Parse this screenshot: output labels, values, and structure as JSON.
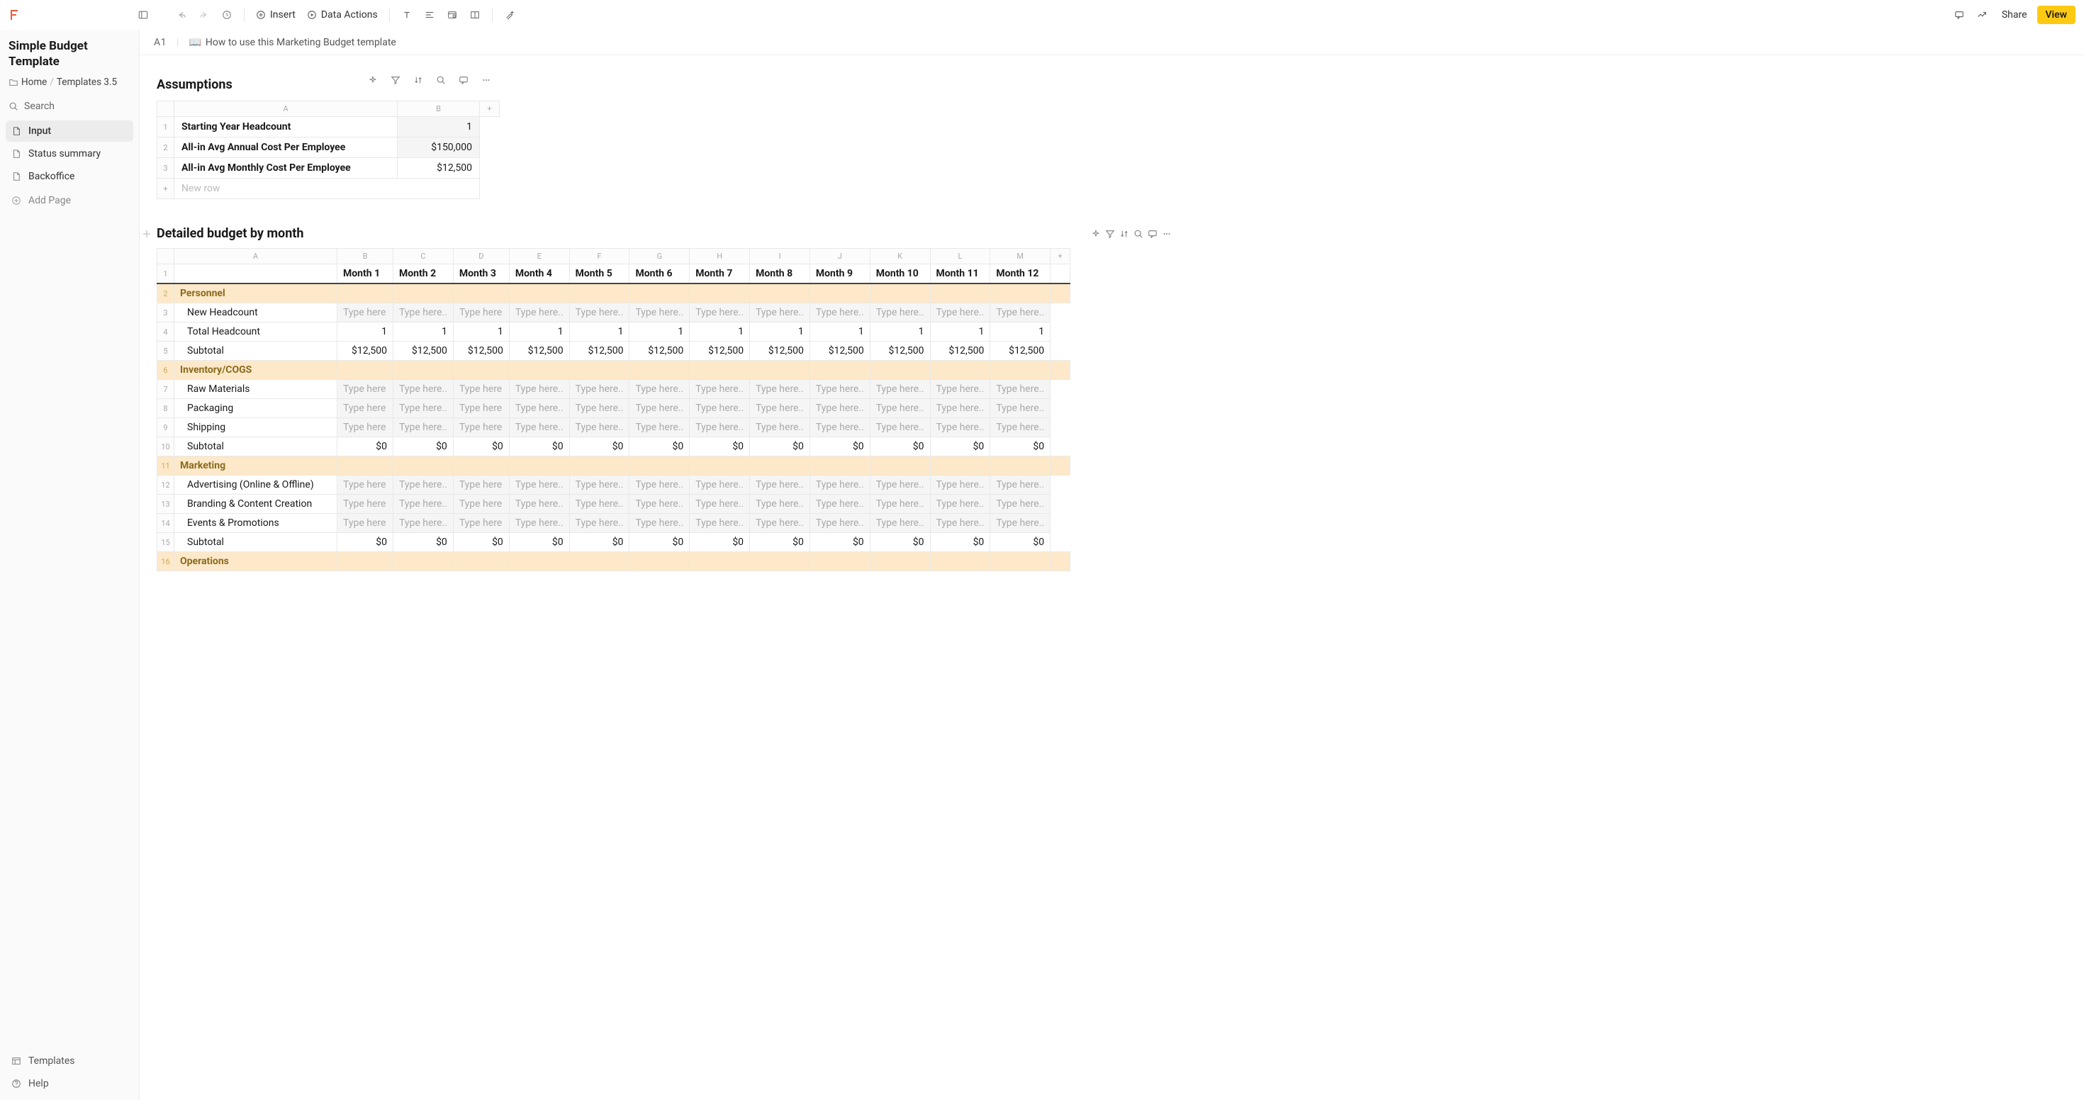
{
  "toolbar": {
    "insert_label": "Insert",
    "data_actions_label": "Data Actions",
    "share_label": "Share",
    "view_label": "View"
  },
  "sidebar": {
    "title": "Simple Budget Template",
    "home": "Home",
    "templates": "Templates 3.5",
    "search": "Search",
    "items": [
      {
        "label": "Input",
        "active": true
      },
      {
        "label": "Status summary",
        "active": false
      },
      {
        "label": "Backoffice",
        "active": false
      }
    ],
    "add_page": "Add Page",
    "footer": {
      "templates": "Templates",
      "help": "Help"
    }
  },
  "cellbar": {
    "ref": "A1",
    "desc": "How to use this Marketing Budget template",
    "emoji": "📖"
  },
  "assumptions": {
    "title": "Assumptions",
    "columns": [
      "A",
      "B"
    ],
    "add_col": "+",
    "rows": [
      {
        "n": "1",
        "label": "Starting Year Headcount",
        "value": "1",
        "grey": true,
        "bold": true
      },
      {
        "n": "2",
        "label": "All-in Avg Annual Cost Per Employee",
        "value": "$150,000",
        "grey": true,
        "bold": true
      },
      {
        "n": "3",
        "label": "All-in Avg Monthly Cost Per Employee",
        "value": "$12,500",
        "grey": false,
        "bold": true
      }
    ],
    "new_row": "New row"
  },
  "detailed": {
    "title": "Detailed budget by month",
    "columns": [
      "A",
      "B",
      "C",
      "D",
      "E",
      "F",
      "G",
      "H",
      "I",
      "J",
      "K",
      "L",
      "M"
    ],
    "add_col": "+",
    "month_headers": [
      "Month 1",
      "Month 2",
      "Month 3",
      "Month 4",
      "Month 5",
      "Month 6",
      "Month 7",
      "Month 8",
      "Month 9",
      "Month 10",
      "Month 11",
      "Month 12"
    ],
    "placeholder_short": "Type here",
    "placeholder_trunc": "Type here..",
    "rows": [
      {
        "n": "1",
        "type": "header"
      },
      {
        "n": "2",
        "type": "section",
        "label": "Personnel"
      },
      {
        "n": "3",
        "type": "input",
        "label": "New Headcount"
      },
      {
        "n": "4",
        "type": "value",
        "label": "Total Headcount",
        "values": [
          "1",
          "1",
          "1",
          "1",
          "1",
          "1",
          "1",
          "1",
          "1",
          "1",
          "1",
          "1"
        ]
      },
      {
        "n": "5",
        "type": "value",
        "label": "Subtotal",
        "values": [
          "$12,500",
          "$12,500",
          "$12,500",
          "$12,500",
          "$12,500",
          "$12,500",
          "$12,500",
          "$12,500",
          "$12,500",
          "$12,500",
          "$12,500",
          "$12,500"
        ]
      },
      {
        "n": "6",
        "type": "section",
        "label": "Inventory/COGS"
      },
      {
        "n": "7",
        "type": "input",
        "label": "Raw Materials"
      },
      {
        "n": "8",
        "type": "input",
        "label": "Packaging"
      },
      {
        "n": "9",
        "type": "input",
        "label": "Shipping"
      },
      {
        "n": "10",
        "type": "value",
        "label": "Subtotal",
        "values": [
          "$0",
          "$0",
          "$0",
          "$0",
          "$0",
          "$0",
          "$0",
          "$0",
          "$0",
          "$0",
          "$0",
          "$0"
        ]
      },
      {
        "n": "11",
        "type": "section",
        "label": "Marketing"
      },
      {
        "n": "12",
        "type": "input",
        "label": "Advertising (Online & Offline)"
      },
      {
        "n": "13",
        "type": "input",
        "label": "Branding & Content Creation"
      },
      {
        "n": "14",
        "type": "input",
        "label": "Events & Promotions"
      },
      {
        "n": "15",
        "type": "value",
        "label": "Subtotal",
        "values": [
          "$0",
          "$0",
          "$0",
          "$0",
          "$0",
          "$0",
          "$0",
          "$0",
          "$0",
          "$0",
          "$0",
          "$0"
        ]
      },
      {
        "n": "16",
        "type": "section",
        "label": "Operations"
      }
    ]
  }
}
